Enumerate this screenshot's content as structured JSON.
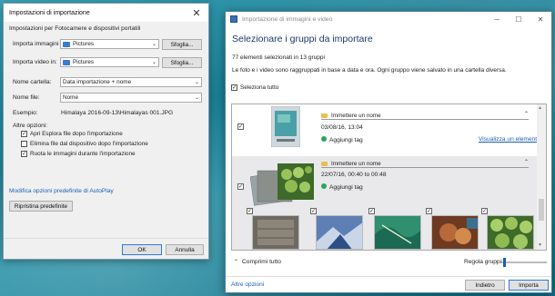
{
  "left_dialog": {
    "title": "Impostazioni di importazione",
    "section_header": "Impostazioni per Fotocamere e dispositivi portatili",
    "import_images_label": "Importa immagini in:",
    "import_images_value": "Pictures",
    "browse1": "Sfoglia...",
    "import_videos_label": "Importa video in:",
    "import_videos_value": "Pictures",
    "browse2": "Sfoglia...",
    "folder_name_label": "Nome cartella:",
    "folder_name_value": "Data importazione + nome",
    "file_name_label": "Nome file:",
    "file_name_value": "Nome",
    "example_label": "Esempio:",
    "example_value": "Himalaya 2016-09-13\\Himalayas 001.JPG",
    "other_options_label": "Altre opzioni:",
    "options": [
      {
        "label": "Apri Esplora file dopo l'importazione",
        "checked": true
      },
      {
        "label": "Elimina file dal dispositivo dopo l'importazione",
        "checked": false
      },
      {
        "label": "Ruota le immagini durante l'importazione",
        "checked": true
      }
    ],
    "autoplay_link": "Modifica opzioni predefinite di AutoPlay",
    "reset_button": "Ripristina predefinite",
    "ok_button": "OK",
    "cancel_button": "Annulla"
  },
  "right_window": {
    "title": "Importazione di immagini e video",
    "heading": "Selezionare i gruppi da importare",
    "count_text": "77 elementi selezionati in 13 gruppi",
    "description": "Le foto e i video sono raggruppati in base a data e ora. Ogni gruppo viene salvato in una cartella diversa.",
    "select_all": "Seleziona tutto",
    "groups": [
      {
        "name_placeholder": "Immettere un nome",
        "date": "03/08/16, 13:04",
        "tag_label": "Aggiungi tag",
        "view_link": "Visualizza un elemento"
      },
      {
        "name_placeholder": "Immettere un nome",
        "date": "22/07/16, 00:40 to 00:48",
        "tag_label": "Aggiungi tag"
      }
    ],
    "collapse_all": "Comprimi tutto",
    "adjust_groups": "Regola gruppi:",
    "more_options_link": "Altre opzioni",
    "back_button": "Indietro",
    "import_button": "Importa"
  },
  "colors": {
    "heading": "#1b3a6b",
    "link": "#1a5fb4",
    "primary_border": "#2c7be5"
  }
}
